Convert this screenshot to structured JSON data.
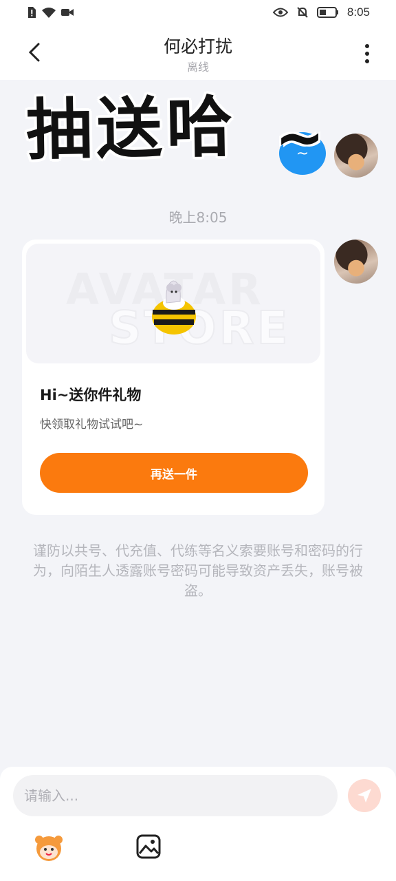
{
  "status_bar": {
    "time": "8:05"
  },
  "header": {
    "title": "何必打扰",
    "subtitle": "离线"
  },
  "overlay": {
    "caption": "抽送哈",
    "tilde": "~"
  },
  "chat": {
    "faded_time_partial": "上",
    "blue_bubble_text": "~",
    "timestamp": "晚上8:05",
    "gift_card": {
      "watermark_line1": "AVATAR",
      "watermark_line2": "STORE",
      "title": "Hi~送你件礼物",
      "description": "快领取礼物试试吧~",
      "button_label": "再送一件"
    },
    "warning": "谨防以共号、代充值、代练等名义索要账号和密码的行为，向陌生人透露账号密码可能导致资产丢失，账号被盗。"
  },
  "input": {
    "placeholder": "请输入..."
  },
  "colors": {
    "accent": "#fb7a0e",
    "blue_bubble": "#2196f3",
    "send_disabled": "#fddad1"
  }
}
